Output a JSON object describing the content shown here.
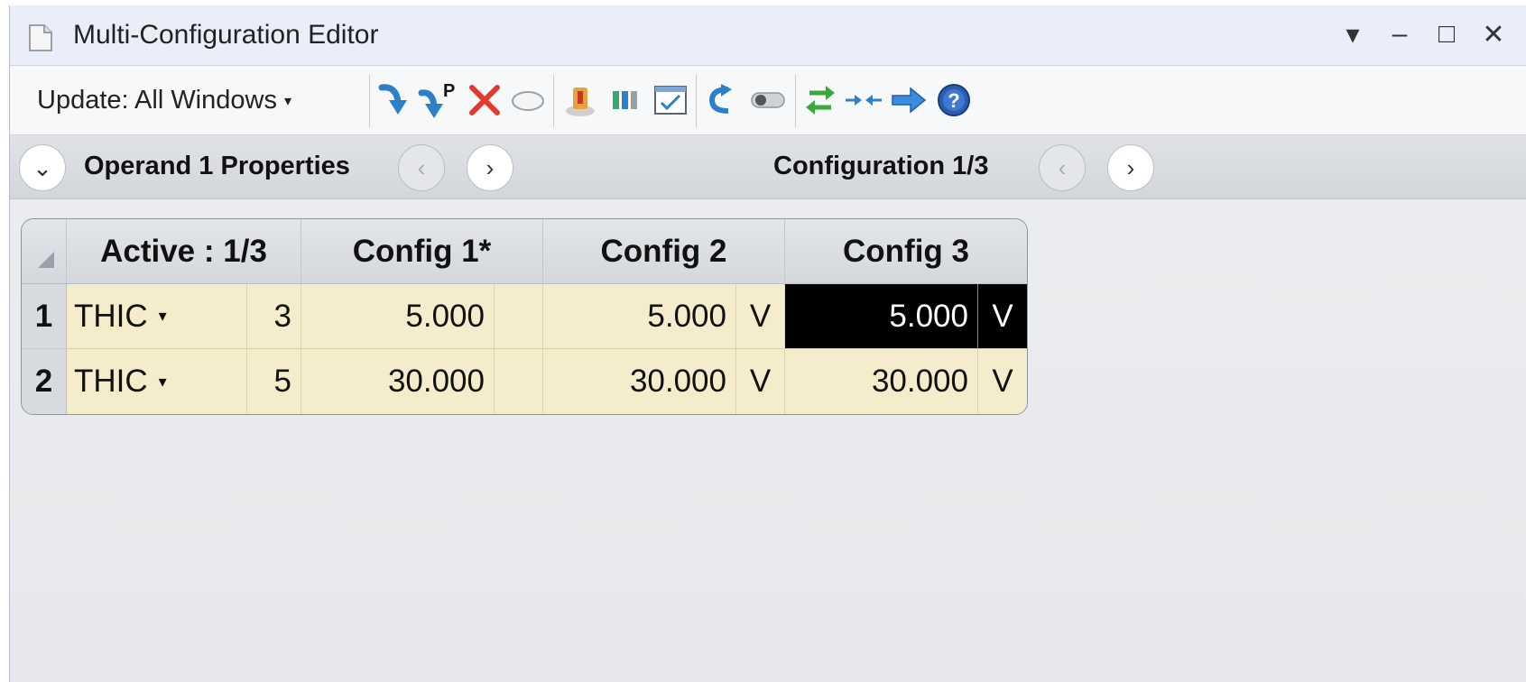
{
  "window": {
    "title": "Multi-Configuration Editor",
    "controls": {
      "menu": "▾",
      "minimize": "–",
      "maximize": "□",
      "close": "✕"
    }
  },
  "toolbar": {
    "update_label": "Update: All Windows",
    "update_caret": "▾",
    "tools": [
      "insert-operand-icon",
      "insert-after-icon",
      "delete-operand-icon",
      "ellipse-icon",
      "configuration-icon",
      "columns-icon",
      "checklist-icon",
      "undo-arrow-icon",
      "toggle-icon",
      "swap-arrows-icon",
      "collapse-arrows-icon",
      "right-arrow-icon",
      "help-icon"
    ],
    "insert_after_letter": "P"
  },
  "nav": {
    "expand_symbol": "⌄",
    "operand_label": "Operand  1 Properties",
    "prev_symbol": "‹",
    "next_symbol": "›",
    "config_label": "Configuration 1/3"
  },
  "grid": {
    "headers": [
      "Active : 1/3",
      "Config 1*",
      "Config 2",
      "Config 3"
    ],
    "rows": [
      {
        "index": "1",
        "operand": "THIC",
        "dropdown": "▾",
        "param": "3",
        "values": [
          {
            "value": "5.000",
            "flag": ""
          },
          {
            "value": "5.000",
            "flag": "V"
          },
          {
            "value": "5.000",
            "flag": "V"
          }
        ]
      },
      {
        "index": "2",
        "operand": "THIC",
        "dropdown": "▾",
        "param": "5",
        "values": [
          {
            "value": "30.000",
            "flag": ""
          },
          {
            "value": "30.000",
            "flag": "V"
          },
          {
            "value": "30.000",
            "flag": "V"
          }
        ]
      }
    ],
    "selected_cell": "row 1, Config 3"
  },
  "colors": {
    "cell_bg": "#f4eccb",
    "selected_bg": "#000000",
    "header_bg": "#d9dce1",
    "title_bg": "#e9eef8"
  }
}
